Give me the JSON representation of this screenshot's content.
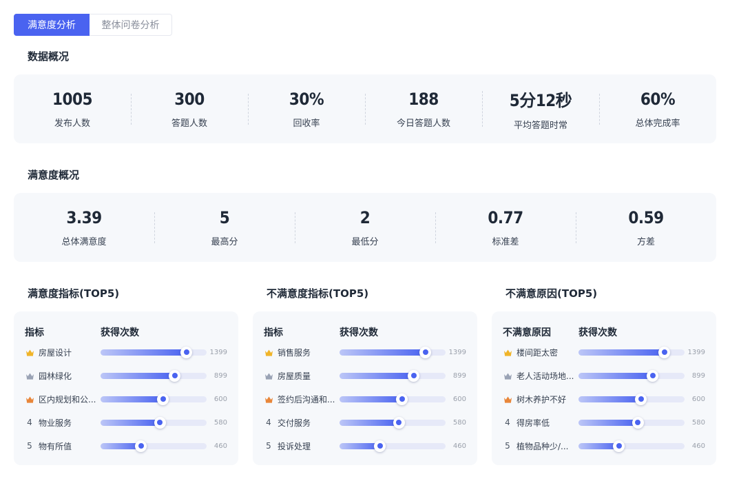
{
  "tabs": [
    {
      "label": "满意度分析",
      "active": true
    },
    {
      "label": "整体问卷分析",
      "active": false
    }
  ],
  "overview": {
    "title": "数据概况",
    "stats": [
      {
        "value": "1005",
        "label": "发布人数"
      },
      {
        "value": "300",
        "label": "答题人数"
      },
      {
        "value": "30%",
        "label": "回收率"
      },
      {
        "value": "188",
        "label": "今日答题人数"
      },
      {
        "value": "5分12秒",
        "label": "平均答题时常"
      },
      {
        "value": "60%",
        "label": "总体完成率"
      }
    ]
  },
  "satisfaction": {
    "title": "满意度概况",
    "stats": [
      {
        "value": "3.39",
        "label": "总体满意度"
      },
      {
        "value": "5",
        "label": "最高分"
      },
      {
        "value": "2",
        "label": "最低分"
      },
      {
        "value": "0.77",
        "label": "标准差"
      },
      {
        "value": "0.59",
        "label": "方差"
      }
    ]
  },
  "colors": {
    "accent": "#4a63f0",
    "gold": "#f0b429",
    "silver": "#9aa3b5",
    "bronze": "#e8863a"
  },
  "rank_tables": [
    {
      "title": "满意度指标(TOP5)",
      "col1": "指标",
      "col2": "获得次数",
      "max": 1399,
      "rows": [
        {
          "rank": "crown-gold",
          "label": "房屋设计",
          "count": 1399,
          "fill": 0.81
        },
        {
          "rank": "crown-silver",
          "label": "园林绿化",
          "count": 899,
          "fill": 0.7
        },
        {
          "rank": "crown-bronze",
          "label": "区内规划和公...",
          "count": 600,
          "fill": 0.59
        },
        {
          "rank": "4",
          "label": "物业服务",
          "count": 580,
          "fill": 0.56
        },
        {
          "rank": "5",
          "label": "物有所值",
          "count": 460,
          "fill": 0.38
        }
      ]
    },
    {
      "title": "不满意度指标(TOP5)",
      "col1": "指标",
      "col2": "获得次数",
      "max": 1399,
      "rows": [
        {
          "rank": "crown-gold",
          "label": "销售服务",
          "count": 1399,
          "fill": 0.81
        },
        {
          "rank": "crown-silver",
          "label": "房屋质量",
          "count": 899,
          "fill": 0.7
        },
        {
          "rank": "crown-bronze",
          "label": "签约后沟通和...",
          "count": 600,
          "fill": 0.59
        },
        {
          "rank": "4",
          "label": "交付服务",
          "count": 580,
          "fill": 0.56
        },
        {
          "rank": "5",
          "label": "投诉处理",
          "count": 460,
          "fill": 0.38
        }
      ]
    },
    {
      "title": "不满意原因(TOP5)",
      "col1": "不满意原因",
      "col2": "获得次数",
      "max": 1399,
      "rows": [
        {
          "rank": "crown-gold",
          "label": "楼间距太密",
          "count": 1399,
          "fill": 0.81
        },
        {
          "rank": "crown-silver",
          "label": "老人活动场地...",
          "count": 899,
          "fill": 0.7
        },
        {
          "rank": "crown-bronze",
          "label": "树木养护不好",
          "count": 600,
          "fill": 0.59
        },
        {
          "rank": "4",
          "label": "得房率低",
          "count": 580,
          "fill": 0.56
        },
        {
          "rank": "5",
          "label": "植物品种少/...",
          "count": 460,
          "fill": 0.38
        }
      ]
    }
  ]
}
